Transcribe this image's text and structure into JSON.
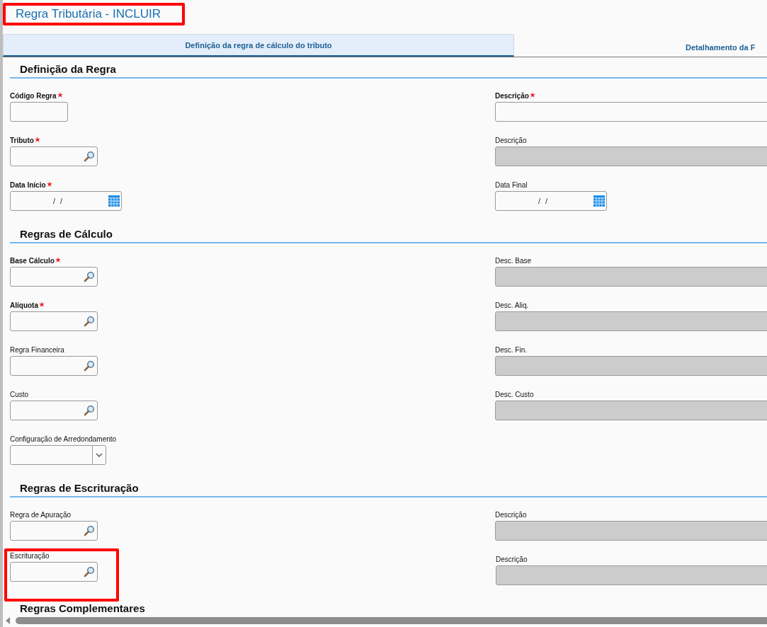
{
  "title": {
    "text": "Regra Tributária - INCLUIR",
    "highlighted": true
  },
  "tabs": [
    {
      "label": "Definição da regra de cálculo do tributo",
      "selected": true
    },
    {
      "label": "Detalhamento da F",
      "selected": false
    }
  ],
  "sections": [
    {
      "title": "Definição da Regra",
      "rows": [
        {
          "left": {
            "label": "Código Regra",
            "required": true,
            "kind": "text",
            "highlighted": false
          },
          "right": {
            "label": "Descrição",
            "required": true,
            "kind": "text"
          }
        },
        {
          "left": {
            "label": "Tributo",
            "required": true,
            "kind": "lookup",
            "highlighted": false
          },
          "right": {
            "label": "Descrição",
            "required": false,
            "kind": "readonly"
          }
        },
        {
          "left": {
            "label": "Data Início",
            "required": true,
            "kind": "date",
            "value": "/ /",
            "highlighted": false
          },
          "right": {
            "label": "Data Final",
            "required": false,
            "kind": "date",
            "value": "/ /"
          }
        }
      ]
    },
    {
      "title": "Regras de Cálculo",
      "rows": [
        {
          "left": {
            "label": "Base Cálculo",
            "required": true,
            "kind": "lookup",
            "highlighted": false
          },
          "right": {
            "label": "Desc. Base",
            "required": false,
            "kind": "readonly"
          }
        },
        {
          "left": {
            "label": "Alíquota",
            "required": true,
            "kind": "lookup",
            "highlighted": false
          },
          "right": {
            "label": "Desc. Aliq.",
            "required": false,
            "kind": "readonly"
          }
        },
        {
          "left": {
            "label": "Regra Financeira",
            "required": false,
            "kind": "lookup",
            "highlighted": false
          },
          "right": {
            "label": "Desc. Fin.",
            "required": false,
            "kind": "readonly"
          }
        },
        {
          "left": {
            "label": "Custo",
            "required": false,
            "kind": "lookup",
            "highlighted": false
          },
          "right": {
            "label": "Desc. Custo",
            "required": false,
            "kind": "readonly"
          }
        },
        {
          "left": {
            "label": "Configuração de Arredondamento",
            "required": false,
            "kind": "select",
            "highlighted": false
          }
        }
      ]
    },
    {
      "title": "Regras de Escrituração",
      "rows": [
        {
          "left": {
            "label": "Regra de Apuração",
            "required": false,
            "kind": "lookup",
            "highlighted": false
          },
          "right": {
            "label": "Descrição",
            "required": false,
            "kind": "readonly"
          }
        },
        {
          "left": {
            "label": "Escrituração",
            "required": false,
            "kind": "lookup",
            "highlighted": true
          },
          "right": {
            "label": "Descrição",
            "required": false,
            "kind": "readonly"
          }
        }
      ]
    },
    {
      "title": "Regras Complementares"
    }
  ]
}
